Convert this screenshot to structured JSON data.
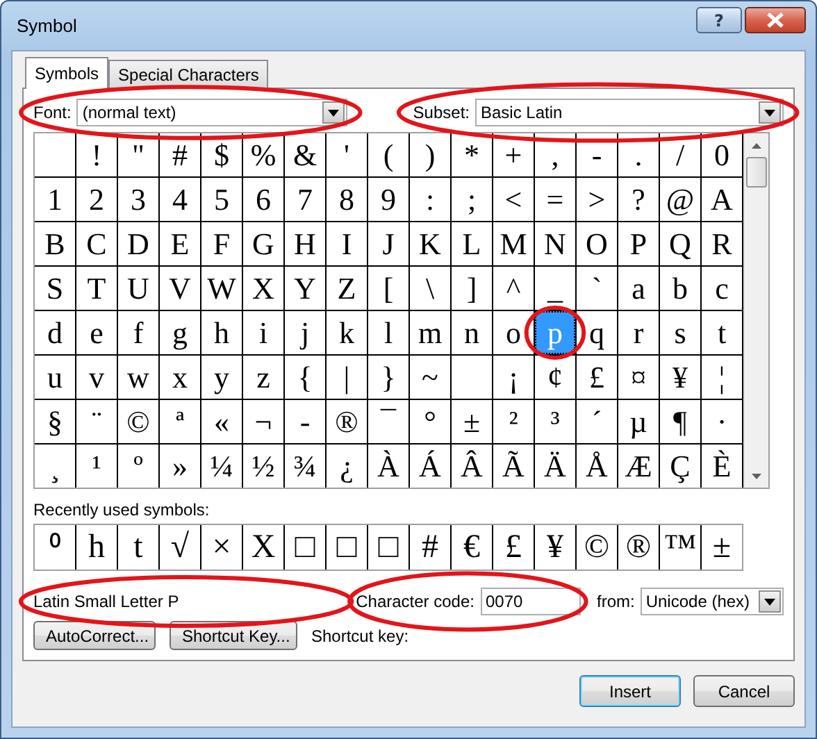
{
  "window": {
    "title": "Symbol",
    "help_label": "?"
  },
  "tabs": [
    {
      "label": "Symbols",
      "selected": true
    },
    {
      "label": "Special Characters",
      "selected": false
    }
  ],
  "font": {
    "label": "Font:",
    "value": "(normal text)",
    "circled": true
  },
  "subset": {
    "label": "Subset:",
    "value": "Basic Latin",
    "circled": true
  },
  "symbol_grid": {
    "circle_on_selected": true,
    "rows": [
      [
        {
          "selected": false
        },
        {
          "char": "!",
          "selected": false
        },
        {
          "char": "\"",
          "selected": false
        },
        {
          "char": "#",
          "selected": false
        },
        {
          "char": "$",
          "selected": false
        },
        {
          "char": "%",
          "selected": false
        },
        {
          "char": "&",
          "selected": false
        },
        {
          "char": "'",
          "selected": false
        },
        {
          "char": "(",
          "selected": false
        },
        {
          "char": ")",
          "selected": false
        },
        {
          "char": "*",
          "selected": false
        },
        {
          "char": "+",
          "selected": false
        },
        {
          "char": ",",
          "selected": false
        },
        {
          "char": "-",
          "selected": false
        },
        {
          "char": ".",
          "selected": false
        },
        {
          "char": "/",
          "selected": false
        },
        {
          "char": "0",
          "selected": false
        }
      ],
      [
        {
          "char": "1",
          "selected": false
        },
        {
          "char": "2",
          "selected": false
        },
        {
          "char": "3",
          "selected": false
        },
        {
          "char": "4",
          "selected": false
        },
        {
          "char": "5",
          "selected": false
        },
        {
          "char": "6",
          "selected": false
        },
        {
          "char": "7",
          "selected": false
        },
        {
          "char": "8",
          "selected": false
        },
        {
          "char": "9",
          "selected": false
        },
        {
          "char": ":",
          "selected": false
        },
        {
          "char": ";",
          "selected": false
        },
        {
          "char": "<",
          "selected": false
        },
        {
          "char": "=",
          "selected": false
        },
        {
          "char": ">",
          "selected": false
        },
        {
          "char": "?",
          "selected": false
        },
        {
          "char": "@",
          "selected": false
        },
        {
          "char": "A",
          "selected": false
        }
      ],
      [
        {
          "char": "B",
          "selected": false
        },
        {
          "char": "C",
          "selected": false
        },
        {
          "char": "D",
          "selected": false
        },
        {
          "char": "E",
          "selected": false
        },
        {
          "char": "F",
          "selected": false
        },
        {
          "char": "G",
          "selected": false
        },
        {
          "char": "H",
          "selected": false
        },
        {
          "char": "I",
          "selected": false
        },
        {
          "char": "J",
          "selected": false
        },
        {
          "char": "K",
          "selected": false
        },
        {
          "char": "L",
          "selected": false
        },
        {
          "char": "M",
          "selected": false
        },
        {
          "char": "N",
          "selected": false
        },
        {
          "char": "O",
          "selected": false
        },
        {
          "char": "P",
          "selected": false
        },
        {
          "char": "Q",
          "selected": false
        },
        {
          "char": "R",
          "selected": false
        }
      ],
      [
        {
          "char": "S",
          "selected": false
        },
        {
          "char": "T",
          "selected": false
        },
        {
          "char": "U",
          "selected": false
        },
        {
          "char": "V",
          "selected": false
        },
        {
          "char": "W",
          "selected": false
        },
        {
          "char": "X",
          "selected": false
        },
        {
          "char": "Y",
          "selected": false
        },
        {
          "char": "Z",
          "selected": false
        },
        {
          "char": "[",
          "selected": false
        },
        {
          "char": "\\",
          "selected": false
        },
        {
          "char": "]",
          "selected": false
        },
        {
          "char": "^",
          "selected": false
        },
        {
          "char": "_",
          "selected": false
        },
        {
          "char": "`",
          "selected": false
        },
        {
          "char": "a",
          "selected": false
        },
        {
          "char": "b",
          "selected": false
        },
        {
          "char": "c",
          "selected": false
        }
      ],
      [
        {
          "char": "d",
          "selected": false
        },
        {
          "char": "e",
          "selected": false
        },
        {
          "char": "f",
          "selected": false
        },
        {
          "char": "g",
          "selected": false
        },
        {
          "char": "h",
          "selected": false
        },
        {
          "char": "i",
          "selected": false
        },
        {
          "char": "j",
          "selected": false
        },
        {
          "char": "k",
          "selected": false
        },
        {
          "char": "l",
          "selected": false
        },
        {
          "char": "m",
          "selected": false
        },
        {
          "char": "n",
          "selected": false
        },
        {
          "char": "o",
          "selected": false
        },
        {
          "char": "p",
          "selected": true
        },
        {
          "char": "q",
          "selected": false
        },
        {
          "char": "r",
          "selected": false
        },
        {
          "char": "s",
          "selected": false
        },
        {
          "char": "t",
          "selected": false
        }
      ],
      [
        {
          "char": "u",
          "selected": false
        },
        {
          "char": "v",
          "selected": false
        },
        {
          "char": "w",
          "selected": false
        },
        {
          "char": "x",
          "selected": false
        },
        {
          "char": "y",
          "selected": false
        },
        {
          "char": "z",
          "selected": false
        },
        {
          "char": "{",
          "selected": false
        },
        {
          "char": "|",
          "selected": false
        },
        {
          "char": "}",
          "selected": false
        },
        {
          "char": "~",
          "selected": false
        },
        {
          "selected": false
        },
        {
          "char": "¡",
          "selected": false
        },
        {
          "char": "¢",
          "selected": false
        },
        {
          "char": "£",
          "selected": false
        },
        {
          "char": "¤",
          "selected": false
        },
        {
          "char": "¥",
          "selected": false
        },
        {
          "char": "¦",
          "selected": false
        }
      ],
      [
        {
          "char": "§",
          "selected": false
        },
        {
          "char": "¨",
          "selected": false
        },
        {
          "char": "©",
          "selected": false
        },
        {
          "char": "ª",
          "selected": false
        },
        {
          "char": "«",
          "selected": false
        },
        {
          "char": "¬",
          "selected": false
        },
        {
          "char": "-",
          "selected": false
        },
        {
          "char": "®",
          "selected": false
        },
        {
          "char": "¯",
          "selected": false
        },
        {
          "char": "°",
          "selected": false
        },
        {
          "char": "±",
          "selected": false
        },
        {
          "char": "²",
          "selected": false
        },
        {
          "char": "³",
          "selected": false
        },
        {
          "char": "´",
          "selected": false
        },
        {
          "char": "µ",
          "selected": false
        },
        {
          "char": "¶",
          "selected": false
        },
        {
          "char": "·",
          "selected": false
        }
      ],
      [
        {
          "char": "¸",
          "selected": false
        },
        {
          "char": "¹",
          "selected": false
        },
        {
          "char": "º",
          "selected": false
        },
        {
          "char": "»",
          "selected": false
        },
        {
          "char": "¼",
          "selected": false
        },
        {
          "char": "½",
          "selected": false
        },
        {
          "char": "¾",
          "selected": false
        },
        {
          "char": "¿",
          "selected": false
        },
        {
          "char": "À",
          "selected": false
        },
        {
          "char": "Á",
          "selected": false
        },
        {
          "char": "Â",
          "selected": false
        },
        {
          "char": "Ã",
          "selected": false
        },
        {
          "char": "Ä",
          "selected": false
        },
        {
          "char": "Å",
          "selected": false
        },
        {
          "char": "Æ",
          "selected": false
        },
        {
          "char": "Ç",
          "selected": false
        },
        {
          "char": "È",
          "selected": false
        }
      ]
    ]
  },
  "recent_label": "Recently used symbols:",
  "recent_symbols": [
    "⁰",
    "h",
    "t",
    "√",
    "×",
    "X",
    "□",
    "□",
    "□",
    "#",
    "€",
    "£",
    "¥",
    "©",
    "®",
    "™",
    "±"
  ],
  "description": {
    "text": "Latin Small Letter P",
    "circled": true
  },
  "character_code": {
    "label": "Character code:",
    "value": "0070",
    "circled": true
  },
  "from": {
    "label": "from:",
    "value": "Unicode (hex)"
  },
  "panel_buttons": [
    "AutoCorrect...",
    "Shortcut Key..."
  ],
  "shortcut_key": {
    "label": "Shortcut key:"
  },
  "dialog_buttons": [
    {
      "label": "Insert",
      "default": true
    },
    {
      "label": "Cancel",
      "default": false
    }
  ]
}
